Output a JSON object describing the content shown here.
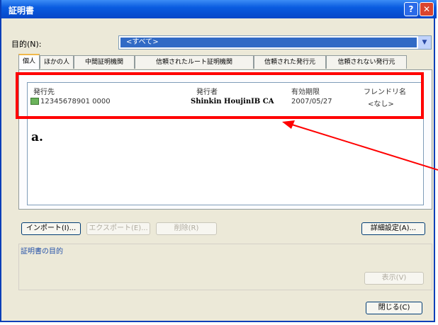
{
  "window": {
    "title": "証明書"
  },
  "purpose": {
    "label": "目的(N):",
    "selected": "<すべて>"
  },
  "tabs": [
    {
      "label": "個人"
    },
    {
      "label": "ほかの人"
    },
    {
      "label": "中間証明機関"
    },
    {
      "label": "信頼されたルート証明機関"
    },
    {
      "label": "信頼された発行元"
    },
    {
      "label": "信頼されない発行元"
    }
  ],
  "table": {
    "headers": [
      "発行先",
      "発行者",
      "有効期限",
      "フレンドリ名"
    ],
    "rows": [
      {
        "issued_to": "12345678901 0000",
        "issued_by": "Shinkin HoujinIB CA",
        "expiration": "2007/05/27",
        "friendly_name": "<なし>"
      }
    ]
  },
  "annotation": {
    "label": "a."
  },
  "buttons": {
    "import": "インポート(I)...",
    "export": "エクスポート(E)...",
    "remove": "削除(R)",
    "advanced": "詳細設定(A)...",
    "view": "表示(V)",
    "close": "閉じる(C)"
  },
  "purposes_section": {
    "label": "証明書の目的"
  },
  "colors": {
    "annotation": "#ff0000",
    "titlebar": "#0a5ce0"
  }
}
